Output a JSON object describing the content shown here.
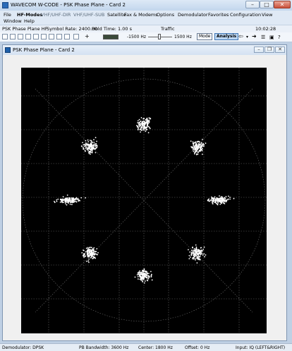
{
  "window": {
    "title": "WAVECOM W-CODE - PSK Phase Plane - Card 2",
    "minimize": "–",
    "maximize": "□",
    "close": "✕"
  },
  "menu": {
    "row1": [
      "File",
      "HF-Modes",
      "VHF/UHF-DIR",
      "VHF/UHF-SUB",
      "Satellite",
      "Fax & Modems",
      "Options",
      "Demodulator",
      "Favorites",
      "Configuration",
      "View"
    ],
    "row2": [
      "Window",
      "Help"
    ]
  },
  "info": {
    "mode": "PSK Phase Plane HF",
    "symbol_rate": "Symbol Rate: 2400.00",
    "hold_time": "Hold Time: 1.00 s",
    "traffic": "Traffic",
    "time": "10:02:28"
  },
  "toolbar": {
    "freq_left": "-1500 Hz",
    "freq_right": "1500 Hz",
    "mode_button": "Mode",
    "analysis_button": "Analysis"
  },
  "child_window": {
    "title": "PSK Phase Plane - Card 2",
    "minimize": "–",
    "restore": "❐",
    "close": "✕"
  },
  "plot": {
    "clusters": [
      {
        "angle": 0,
        "radius": 0.62
      },
      {
        "angle": 45,
        "radius": 0.62
      },
      {
        "angle": 90,
        "radius": 0.62
      },
      {
        "angle": 135,
        "radius": 0.62
      },
      {
        "angle": 180,
        "radius": 0.62
      },
      {
        "angle": 225,
        "radius": 0.62
      },
      {
        "angle": 270,
        "radius": 0.62
      },
      {
        "angle": 315,
        "radius": 0.62
      }
    ]
  },
  "status": {
    "demodulator": "Demodulator: DPSK",
    "pb_bandwidth": "PB Bandwidth: 3600 Hz",
    "center": "Center: 1800 Hz",
    "offset": "Offset: 0 Hz",
    "input": "Input: IQ (LEFT&RIGHT)"
  }
}
